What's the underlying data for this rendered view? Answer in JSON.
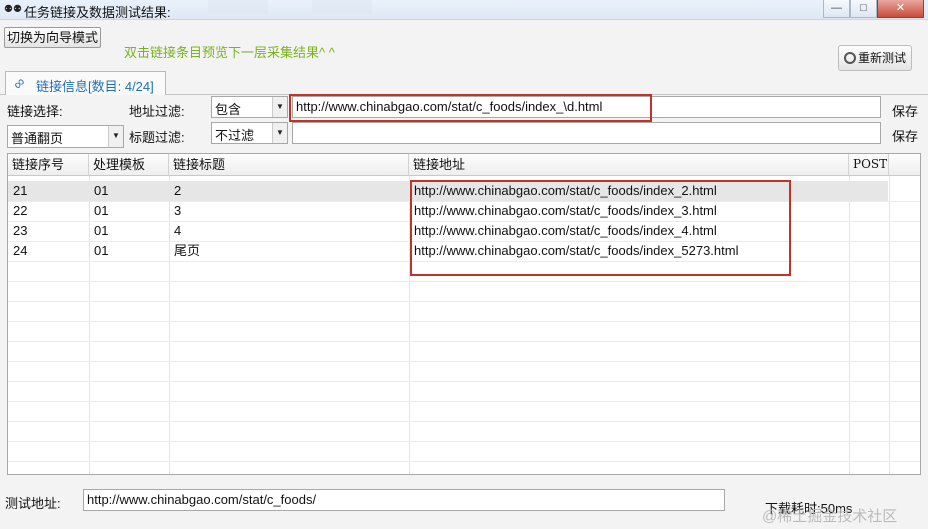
{
  "window": {
    "title": "任务链接及数据测试结果:",
    "controls": {
      "minimize": "—",
      "maximize": "□",
      "close": "✕"
    }
  },
  "toolbar": {
    "wizard_button": "切换为向导模式",
    "hint": "双击链接条目预览下一层采集结果^ ^",
    "retest_button": "重新测试"
  },
  "tab": {
    "label": "链接信息[数目: 4/24]"
  },
  "filters": {
    "link_select_label": "链接选择:",
    "link_select_value": "普通翻页",
    "address_filter_label": "地址过滤:",
    "address_filter_mode": "包含",
    "address_filter_value": "http://www.chinabgao.com/stat/c_foods/index_\\d.html",
    "title_filter_label": "标题过滤:",
    "title_filter_mode": "不过滤",
    "title_filter_value": "",
    "save_label": "保存"
  },
  "table": {
    "headers": [
      "链接序号",
      "处理模板",
      "链接标题",
      "链接地址",
      "POST"
    ],
    "rows": [
      {
        "seq": "21",
        "template": "01",
        "title": "2",
        "url": "http://www.chinabgao.com/stat/c_foods/index_2.html",
        "post": ""
      },
      {
        "seq": "22",
        "template": "01",
        "title": "3",
        "url": "http://www.chinabgao.com/stat/c_foods/index_3.html",
        "post": ""
      },
      {
        "seq": "23",
        "template": "01",
        "title": "4",
        "url": "http://www.chinabgao.com/stat/c_foods/index_4.html",
        "post": ""
      },
      {
        "seq": "24",
        "template": "01",
        "title": "尾页",
        "url": "http://www.chinabgao.com/stat/c_foods/index_5273.html",
        "post": ""
      }
    ],
    "selected_row": 0
  },
  "footer": {
    "test_address_label": "测试地址:",
    "test_address_value": "http://www.chinabgao.com/stat/c_foods/",
    "download_time": "下载耗时:50ms",
    "watermark": "@稀土掘金技术社区"
  },
  "colors": {
    "hint_text": "#7ab31c",
    "highlight_box": "#c0332b",
    "tab_text": "#1f6fb5"
  }
}
